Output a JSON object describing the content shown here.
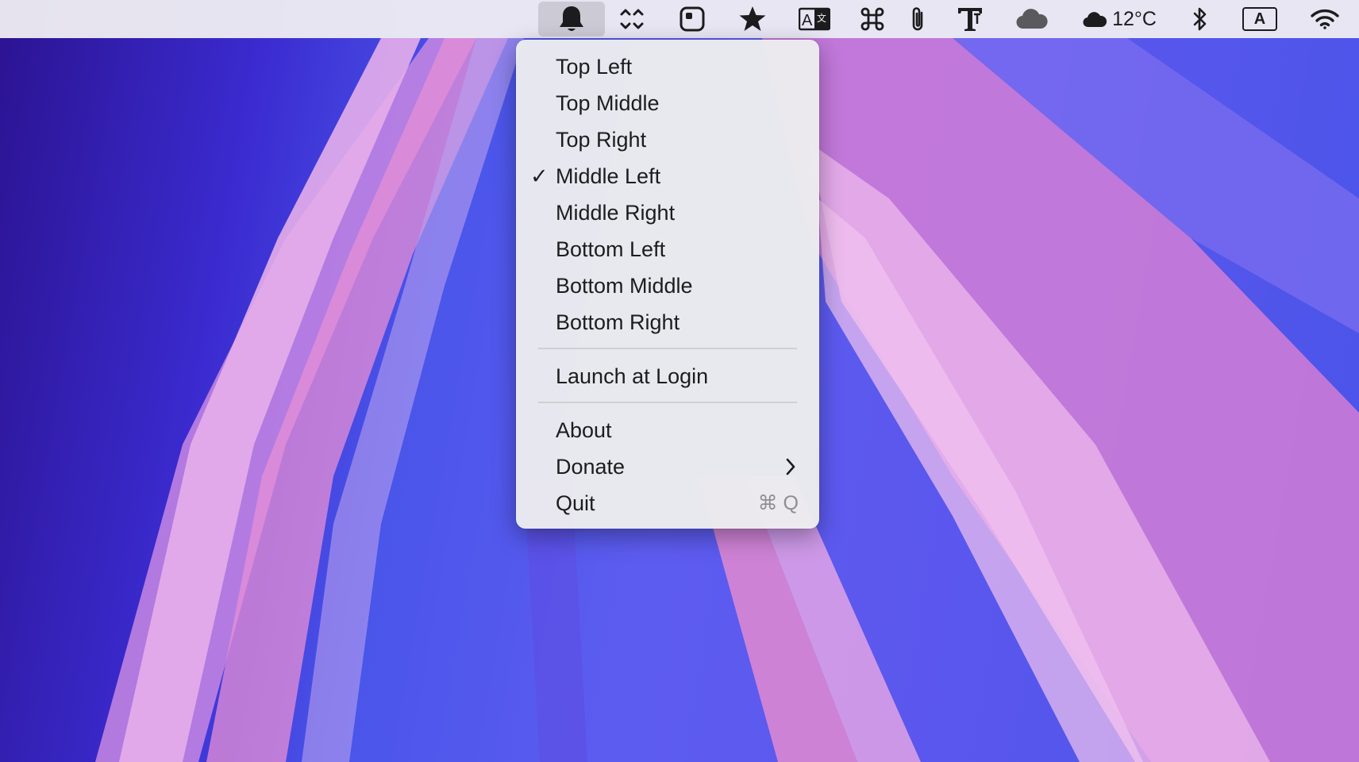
{
  "menubar": {
    "icons": [
      "bell-icon",
      "resize-arrows-icon",
      "rounded-square-icon",
      "star-icon",
      "translate-icon",
      "command-icon",
      "paperclip-icon",
      "text-tool-icon",
      "cloud-icon",
      "weather-cloud-icon",
      "bluetooth-icon",
      "input-source-icon",
      "wifi-icon"
    ],
    "weather_temp": "12°C",
    "input_source_letter": "A"
  },
  "menu": {
    "position_items": [
      {
        "label": "Top Left",
        "checked": false
      },
      {
        "label": "Top Middle",
        "checked": false
      },
      {
        "label": "Top Right",
        "checked": false
      },
      {
        "label": "Middle Left",
        "checked": true
      },
      {
        "label": "Middle Right",
        "checked": false
      },
      {
        "label": "Bottom Left",
        "checked": false
      },
      {
        "label": "Bottom Middle",
        "checked": false
      },
      {
        "label": "Bottom Right",
        "checked": false
      }
    ],
    "check_mark": "✓",
    "launch_at_login": "Launch at Login",
    "about": "About",
    "donate": "Donate",
    "quit": "Quit",
    "quit_shortcut": "⌘ Q"
  },
  "colors": {
    "menubar_bg": "#eeecf2",
    "menu_bg": "#ececee",
    "wallpaper_blue": "#4a55ea",
    "wallpaper_pink": "#e48ad6"
  }
}
